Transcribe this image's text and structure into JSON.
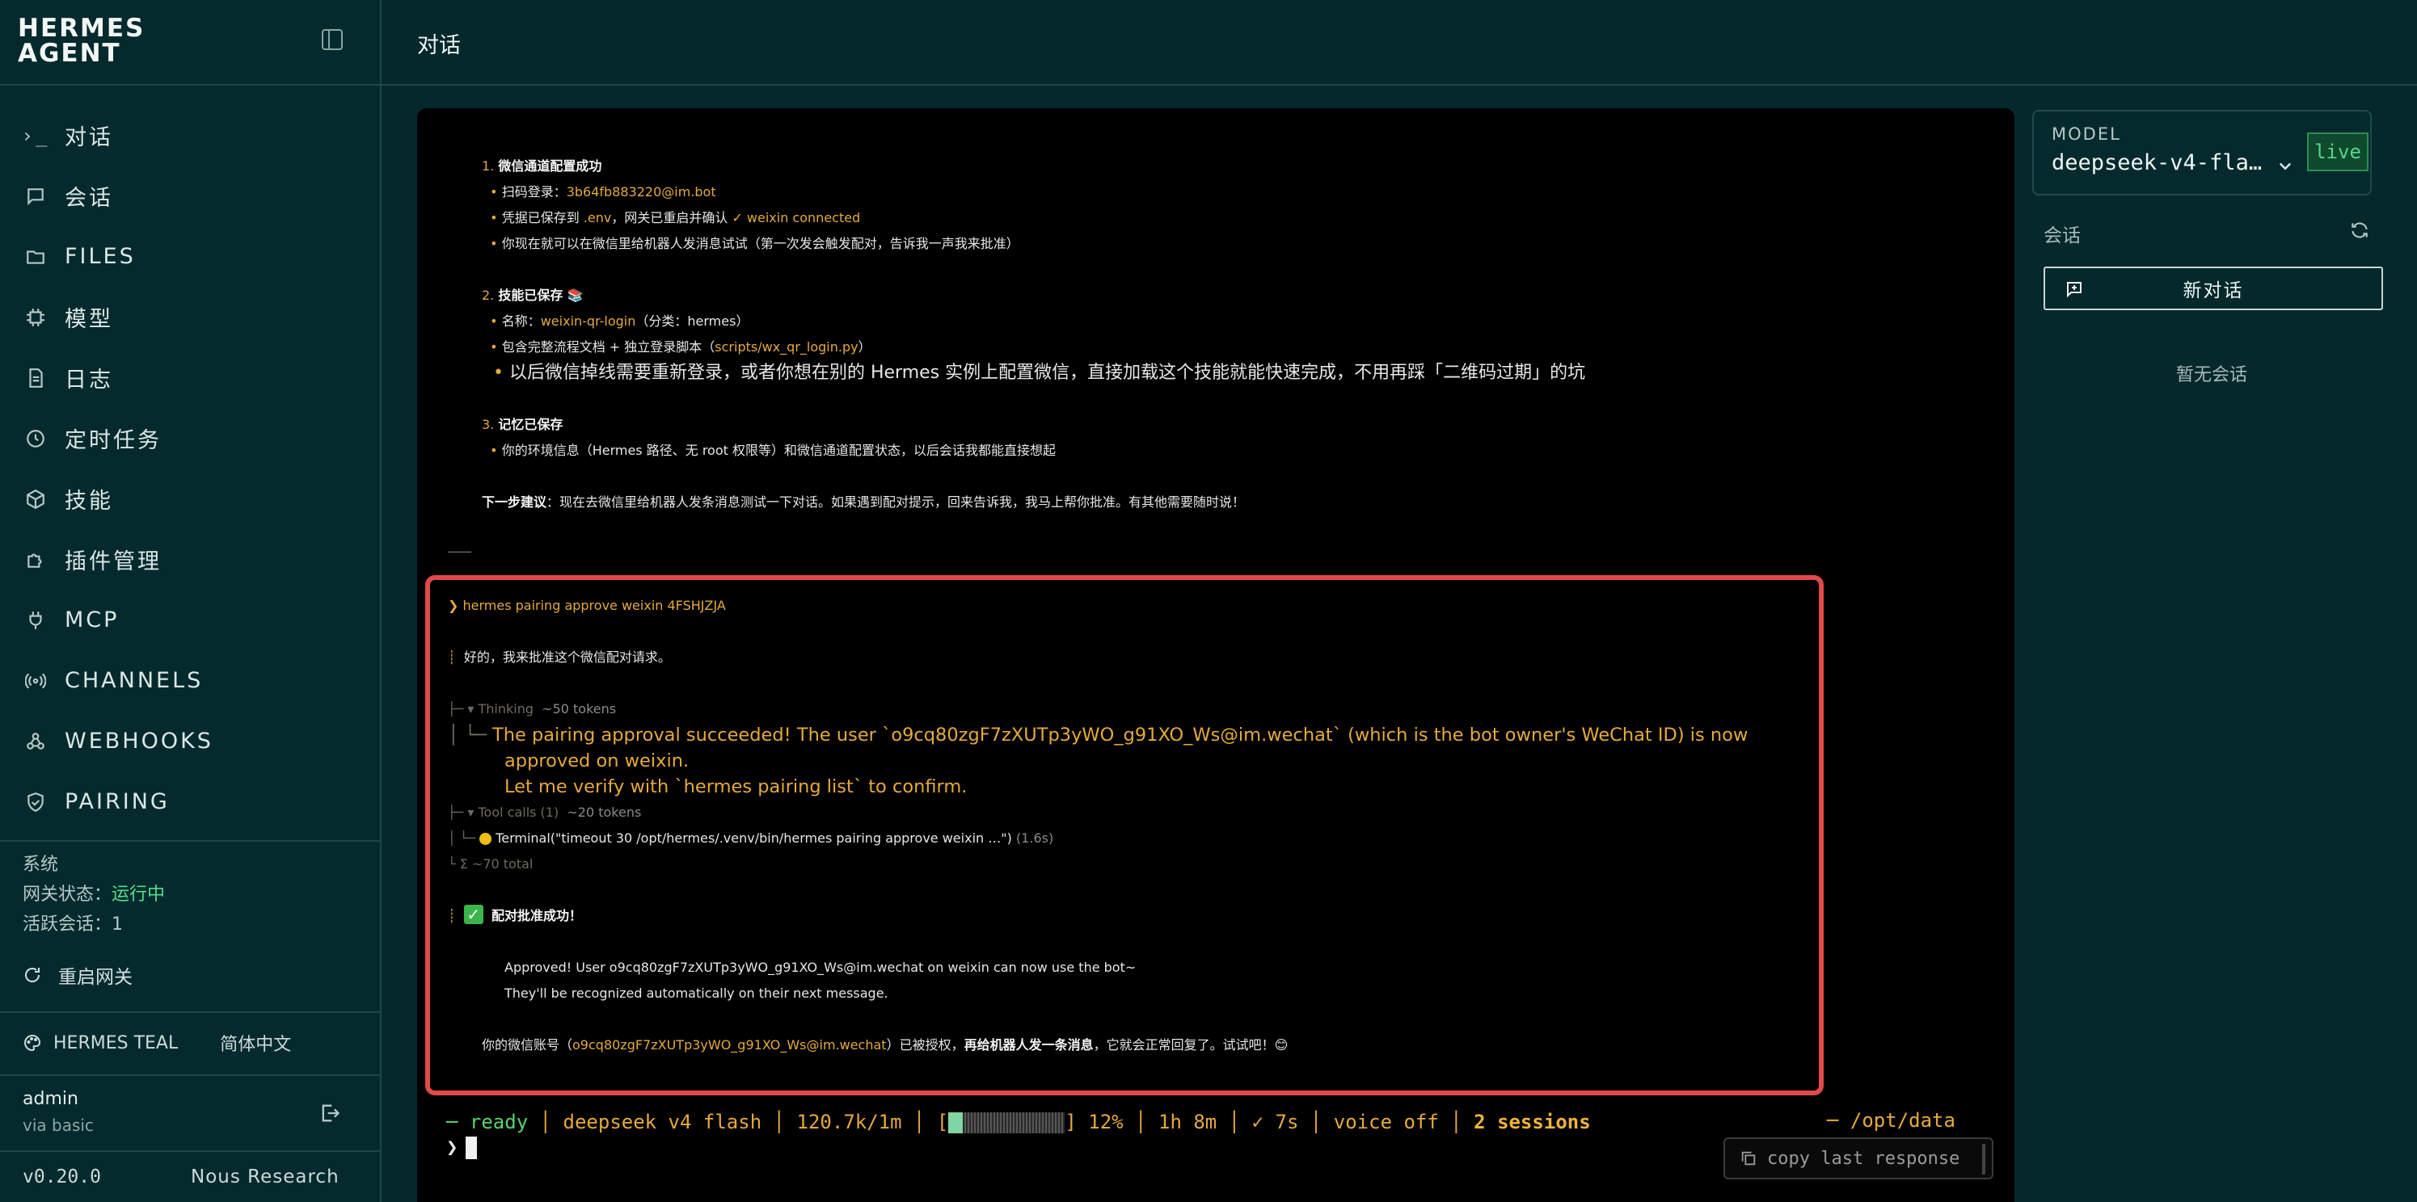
{
  "brand": {
    "line1": "HERMES",
    "line2": "AGENT"
  },
  "nav": [
    {
      "icon": "terminal-icon",
      "label": "对话"
    },
    {
      "icon": "chat-bubble-icon",
      "label": "会话"
    },
    {
      "icon": "folder-icon",
      "label": "FILES"
    },
    {
      "icon": "chip-icon",
      "label": "模型"
    },
    {
      "icon": "file-text-icon",
      "label": "日志"
    },
    {
      "icon": "clock-icon",
      "label": "定时任务"
    },
    {
      "icon": "package-icon",
      "label": "技能"
    },
    {
      "icon": "puzzle-icon",
      "label": "插件管理"
    },
    {
      "icon": "plug-icon",
      "label": "MCP"
    },
    {
      "icon": "radio-icon",
      "label": "CHANNELS"
    },
    {
      "icon": "webhook-icon",
      "label": "WEBHOOKS"
    },
    {
      "icon": "shield-check-icon",
      "label": "PAIRING"
    }
  ],
  "system": {
    "title": "系统",
    "gateway_label": "网关状态：",
    "gateway_value": "运行中",
    "active_label": "活跃会话：",
    "active_value": "1",
    "restart_label": "重启网关"
  },
  "theme": {
    "name": "HERMES TEAL",
    "language": "简体中文"
  },
  "user": {
    "name": "admin",
    "via": "via basic"
  },
  "footer": {
    "version": "v0.20.0",
    "org": "Nous Research"
  },
  "page_title": "对话",
  "terminal": {
    "lines": [
      {
        "t": "1. ",
        "c": "y",
        "b": "微信通道配置成功"
      },
      {
        "t": "  • ",
        "c": "y",
        "s": "扫码登录：",
        "v": "3b64fb883220@im.bot"
      },
      {
        "t": "  • ",
        "c": "y",
        "s": "凭据已保存到 ",
        "v": ".env",
        "s2": "，网关已重启并确认 ",
        "v2": "✓ weixin connected"
      },
      {
        "t": "  • ",
        "c": "y",
        "s": "你现在就可以在微信里给机器人发消息试试（第一次发会触发配对，告诉我一声我来批准）"
      },
      {
        "t": "2. ",
        "c": "y",
        "b": "技能已保存 📚"
      },
      {
        "t": "  • ",
        "c": "y",
        "s": "名称：",
        "v": "weixin-qr-login",
        "s2": "（分类：hermes）"
      },
      {
        "t": "  • ",
        "c": "y",
        "s": "包含完整流程文档 + 独立登录脚本（",
        "v": "scripts/wx_qr_login.py",
        "s2": "）"
      },
      {
        "t": "  • ",
        "c": "y",
        "s": "以后微信掉线需要重新登录，或者你想在别的 Hermes 实例上配置微信，直接加载这个技能就能快速完成，不用再踩「二维码过期」的坑"
      },
      {
        "t": "3. ",
        "c": "y",
        "b": "记忆已保存"
      },
      {
        "t": "  • ",
        "c": "y",
        "s": "你的环境信息（Hermes 路径、无 root 权限等）和微信通道配置状态，以后会话我都能直接想起"
      }
    ],
    "next_label": "下一步建议",
    "next_text": "：现在去微信里给机器人发条消息测试一下对话。如果遇到配对提示，回来告诉我，我马上帮你批准。有其他需要随时说！",
    "rule": "───",
    "command": "❯ hermes pairing approve weixin 4FSHJZJA",
    "reply1": "好的，我来批准这个微信配对请求。",
    "thinking_label": "▾ Thinking",
    "thinking_tokens": "~50 tokens",
    "thinking_text1": "The pairing approval succeeded! The user `o9cq80zgF7zXUTp3yWO_g91XO_Ws@im.wechat` (which is the bot owner's WeChat ID) is now",
    "thinking_text2": "approved on weixin.",
    "thinking_text3": "Let me verify with `hermes pairing list` to confirm.",
    "tool_label": "▾ Tool calls (1)",
    "tool_tokens": "~20 tokens",
    "tool_call": "Terminal(\"timeout 30 /opt/hermes/.venv/bin/hermes pairing approve weixin …\")",
    "tool_time": "(1.6s)",
    "total": "Σ ~70 total",
    "success_title": "配对批准成功！",
    "approved1": "Approved! User o9cq80zgF7zXUTp3yWO_g91XO_Ws@im.wechat on weixin can now use the bot~",
    "approved2": "They'll be recognized automatically on their next message.",
    "final_pre": "你的微信账号（",
    "final_account": "o9cq80zgF7zXUTp3yWO_g91XO_Ws@im.wechat",
    "final_mid": "）已被授权，",
    "final_bold": "再给机器人发一条消息",
    "final_post": "，它就会正常回复了。试试吧！😊"
  },
  "statusbar": {
    "ready": "─ ready",
    "model": "deepseek v4 flash",
    "context": "120.7k/1m",
    "progress_percent": 12,
    "percent_label": "12%",
    "elapsed": "1h 8m",
    "last": "✓ 7s",
    "voice": "voice off",
    "sessions": "2 sessions",
    "cwd": "─ /opt/data"
  },
  "prompt": "❯",
  "copy_button": "copy last response",
  "right_panel": {
    "model_label": "MODEL",
    "model_value": "deepseek-v4-fla…",
    "live": "live",
    "sessions_label": "会话",
    "new_chat": "新对话",
    "empty": "暂无会话"
  },
  "colors": {
    "accent_amber": "#e5a93c",
    "green": "#4fe08a",
    "highlight_red": "#e04a48",
    "bg_teal": "#05282b"
  }
}
